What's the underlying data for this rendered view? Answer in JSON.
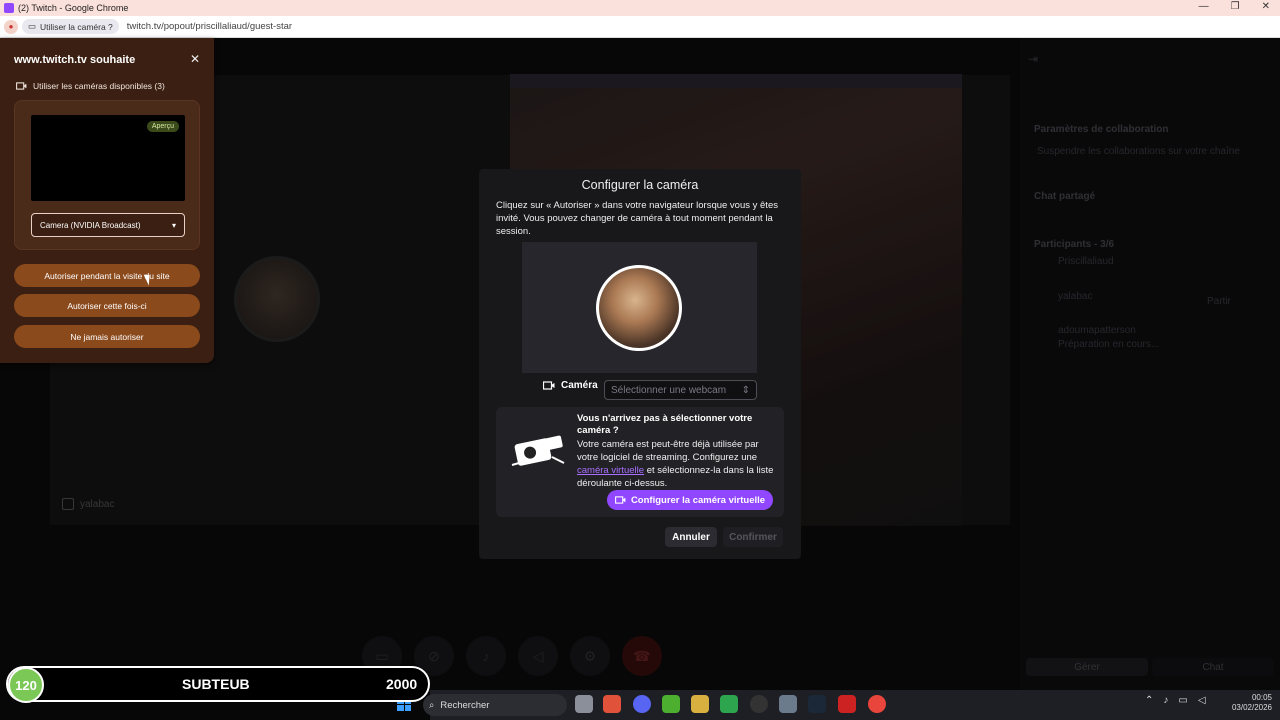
{
  "window": {
    "title": "(2) Twitch - Google Chrome",
    "controls": [
      "—",
      "❐",
      "✕"
    ]
  },
  "address_bar": {
    "permission_chip": "Utiliser la caméra ?",
    "url": "twitch.tv/popout/priscillaliaud/guest-star"
  },
  "permission_popup": {
    "title": "www.twitch.tv souhaite",
    "close": "✕",
    "camera_line": "Utiliser les caméras disponibles (3)",
    "preview_badge": "Aperçu",
    "selected_camera": "Camera (NVIDIA Broadcast)",
    "buttons": {
      "allow_always": "Autoriser pendant la visite du site",
      "allow_once": "Autoriser cette fois-ci",
      "never": "Ne jamais autoriser"
    }
  },
  "modal": {
    "title": "Configurer la caméra",
    "description": "Cliquez sur « Autoriser » dans votre navigateur lorsque vous y êtes invité. Vous pouvez changer de caméra à tout moment pendant la session.",
    "camera_label": "Caméra",
    "camera_placeholder": "Sélectionner une webcam",
    "help_title": "Vous n'arrivez pas à sélectionner votre caméra ?",
    "help_text_before": "Votre caméra est peut-être déjà utilisée par votre logiciel de streaming. Configurez une ",
    "help_link": "caméra virtuelle",
    "help_text_after": " et sélectionnez-la dans la liste déroulante ci-dessus.",
    "virtual_cam_button": "Configurer la caméra virtuelle",
    "cancel": "Annuler",
    "confirm": "Confirmer"
  },
  "stage": {
    "guest_name": "yalabac"
  },
  "sidebar": {
    "collab_title": "Paramètres de collaboration",
    "suspend_link": "Suspendre les collaborations sur votre chaîne",
    "shared_chat": "Chat partagé",
    "participants_title": "Participants - 3/6",
    "participants": [
      {
        "name": "Priscillaliaud",
        "action": ""
      },
      {
        "name": "yalabac",
        "action": "Partir"
      },
      {
        "name": "adoumapatterson",
        "action": "",
        "status": "Préparation en cours..."
      }
    ],
    "tabs": [
      "Gérer",
      "Chat"
    ]
  },
  "sub_goal": {
    "current": "120",
    "label": "SUBTEUB",
    "target": "2000",
    "progress": 0.06
  },
  "taskbar": {
    "search_placeholder": "Rechercher",
    "time": "00:05",
    "date": "03/02/2026"
  }
}
